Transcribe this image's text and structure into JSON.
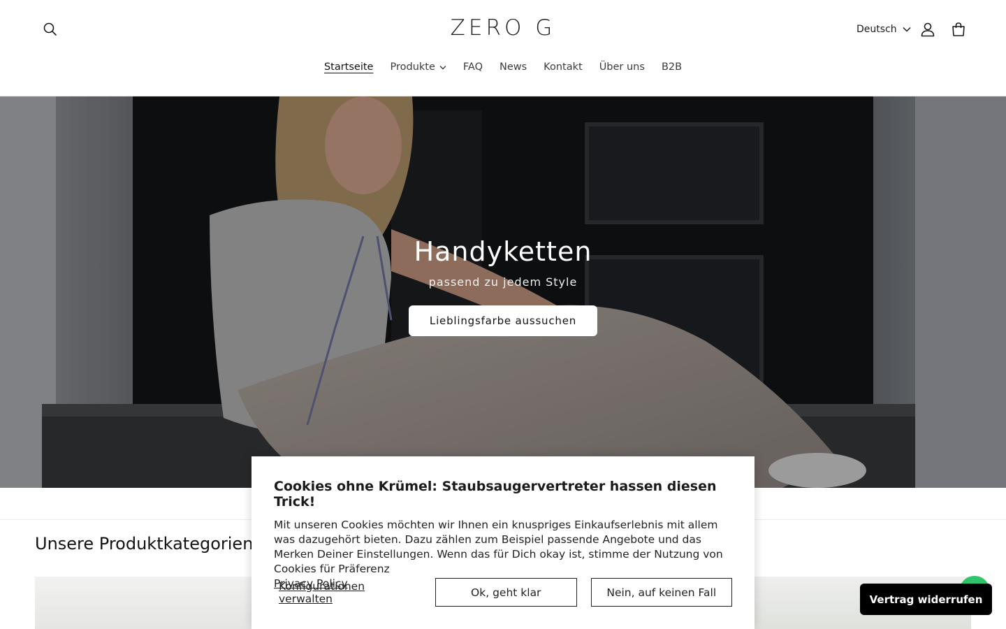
{
  "header": {
    "logo": "ZERO G",
    "language": "Deutsch"
  },
  "nav": {
    "items": [
      {
        "label": "Startseite",
        "active": true
      },
      {
        "label": "Produkte",
        "dropdown": true
      },
      {
        "label": "FAQ"
      },
      {
        "label": "News"
      },
      {
        "label": "Kontakt"
      },
      {
        "label": "Über uns"
      },
      {
        "label": "B2B"
      }
    ]
  },
  "hero": {
    "title": "Handyketten",
    "subtitle": "passend zu jedem Style",
    "button": "Lieblingsfarbe aussuchen"
  },
  "section": {
    "title": "Unsere Produktkategorien:"
  },
  "cookie": {
    "title": "Cookies ohne Krümel: Staubsaugervertreter hassen diesen Trick!",
    "text": "Mit unseren Cookies möchten wir Ihnen ein knuspriges Einkaufserlebnis mit allem was dazugehört bieten. Dazu zählen zum Beispiel passende Angebote und das Merken Deiner Einstellungen. Wenn das für Dich okay ist, stimme der Nutzung von Cookies für Präferenz",
    "policy_link": "Privacy Policy",
    "manage": "Konfigurationen verwalten",
    "accept": "Ok, geht klar",
    "decline": "Nein, auf keinen Fall"
  },
  "floating": {
    "withdraw": "Vertrag widerrufen"
  },
  "icons": {
    "search": "search-icon",
    "account": "account-icon",
    "cart": "cart-icon",
    "chevron": "chevron-down-icon"
  },
  "colors": {
    "withdraw_bg": "#000000",
    "bubble": "#2ec46b"
  }
}
